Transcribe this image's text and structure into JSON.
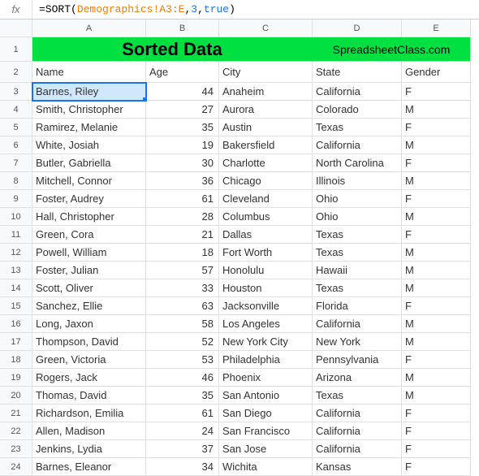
{
  "formula_bar": {
    "fx_label": "fx",
    "eq": "=",
    "func_open": "SORT(",
    "range": "Demographics!A3:E",
    "comma1": ",",
    "sort_col": "3",
    "comma2": ",",
    "ascending": "true",
    "close": ")"
  },
  "columns": [
    "A",
    "B",
    "C",
    "D",
    "E"
  ],
  "title": "Sorted Data",
  "site": "SpreadsheetClass.com",
  "headers": {
    "name": "Name",
    "age": "Age",
    "city": "City",
    "state": "State",
    "gender": "Gender"
  },
  "rows": [
    {
      "n": "3",
      "name": "Barnes, Riley",
      "age": "44",
      "city": "Anaheim",
      "state": "California",
      "gender": "F"
    },
    {
      "n": "4",
      "name": "Smith, Christopher",
      "age": "27",
      "city": "Aurora",
      "state": "Colorado",
      "gender": "M"
    },
    {
      "n": "5",
      "name": "Ramirez, Melanie",
      "age": "35",
      "city": "Austin",
      "state": "Texas",
      "gender": "F"
    },
    {
      "n": "6",
      "name": "White, Josiah",
      "age": "19",
      "city": "Bakersfield",
      "state": "California",
      "gender": "M"
    },
    {
      "n": "7",
      "name": "Butler, Gabriella",
      "age": "30",
      "city": "Charlotte",
      "state": "North Carolina",
      "gender": "F"
    },
    {
      "n": "8",
      "name": "Mitchell, Connor",
      "age": "36",
      "city": "Chicago",
      "state": "Illinois",
      "gender": "M"
    },
    {
      "n": "9",
      "name": "Foster, Audrey",
      "age": "61",
      "city": "Cleveland",
      "state": "Ohio",
      "gender": "F"
    },
    {
      "n": "10",
      "name": "Hall, Christopher",
      "age": "28",
      "city": "Columbus",
      "state": "Ohio",
      "gender": "M"
    },
    {
      "n": "11",
      "name": "Green, Cora",
      "age": "21",
      "city": "Dallas",
      "state": "Texas",
      "gender": "F"
    },
    {
      "n": "12",
      "name": "Powell, William",
      "age": "18",
      "city": "Fort Worth",
      "state": "Texas",
      "gender": "M"
    },
    {
      "n": "13",
      "name": "Foster, Julian",
      "age": "57",
      "city": "Honolulu",
      "state": "Hawaii",
      "gender": "M"
    },
    {
      "n": "14",
      "name": "Scott, Oliver",
      "age": "33",
      "city": "Houston",
      "state": "Texas",
      "gender": "M"
    },
    {
      "n": "15",
      "name": "Sanchez, Ellie",
      "age": "63",
      "city": "Jacksonville",
      "state": "Florida",
      "gender": "F"
    },
    {
      "n": "16",
      "name": "Long, Jaxon",
      "age": "58",
      "city": "Los Angeles",
      "state": "California",
      "gender": "M"
    },
    {
      "n": "17",
      "name": "Thompson, David",
      "age": "52",
      "city": "New York City",
      "state": "New York",
      "gender": "M"
    },
    {
      "n": "18",
      "name": "Green, Victoria",
      "age": "53",
      "city": "Philadelphia",
      "state": "Pennsylvania",
      "gender": "F"
    },
    {
      "n": "19",
      "name": "Rogers, Jack",
      "age": "46",
      "city": "Phoenix",
      "state": "Arizona",
      "gender": "M"
    },
    {
      "n": "20",
      "name": "Thomas, David",
      "age": "35",
      "city": "San Antonio",
      "state": "Texas",
      "gender": "M"
    },
    {
      "n": "21",
      "name": "Richardson, Emilia",
      "age": "61",
      "city": "San Diego",
      "state": "California",
      "gender": "F"
    },
    {
      "n": "22",
      "name": "Allen, Madison",
      "age": "24",
      "city": "San Francisco",
      "state": "California",
      "gender": "F"
    },
    {
      "n": "23",
      "name": "Jenkins, Lydia",
      "age": "37",
      "city": "San Jose",
      "state": "California",
      "gender": "F"
    },
    {
      "n": "24",
      "name": "Barnes, Eleanor",
      "age": "34",
      "city": "Wichita",
      "state": "Kansas",
      "gender": "F"
    }
  ]
}
